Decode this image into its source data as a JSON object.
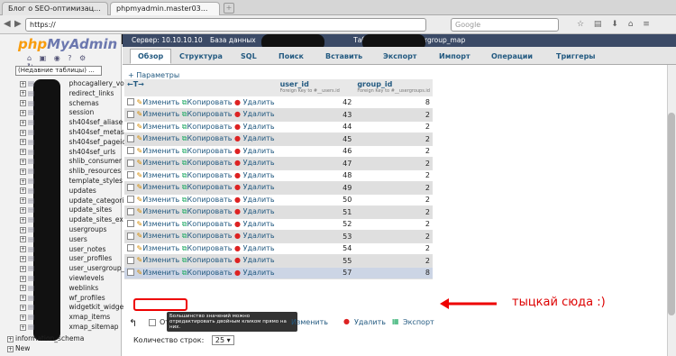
{
  "browser": {
    "tabs": [
      {
        "label": "Блог о SEO-оптимизац..."
      },
      {
        "label": "phpmyadmin.master03..."
      }
    ],
    "url_prefix": "https://",
    "search_placeholder": "Google",
    "search_engine": "8 ▾"
  },
  "sidebar": {
    "logo_php": "php",
    "logo_myadmin": "MyAdmin",
    "recent_select": "(Недавние таблицы) ...",
    "items": [
      "phocagallery_vo",
      "redirect_links",
      "schemas",
      "session",
      "sh404sef_aliase",
      "sh404sef_metas",
      "sh404sef_pageic",
      "sh404sef_urls",
      "shlib_consumer",
      "shlib_resources",
      "template_styles",
      "updates",
      "update_categori",
      "update_sites",
      "update_sites_ex",
      "usergroups",
      "users",
      "user_notes",
      "user_profiles",
      "user_usergroup_",
      "viewlevels",
      "weblinks",
      "wf_profiles",
      "widgetkit_widge",
      "xmap_items",
      "xmap_sitemap"
    ],
    "root_items": [
      "information_schema",
      "New"
    ]
  },
  "breadcrumb": {
    "server": "Сервер: 10.10.10.10",
    "database": "База данных",
    "table": "Таблица",
    "table_name": "user_usergroup_map"
  },
  "tabs": [
    {
      "label": "Обзор",
      "icon": "browse-icon"
    },
    {
      "label": "Структура",
      "icon": "structure-icon"
    },
    {
      "label": "SQL",
      "icon": "sql-icon"
    },
    {
      "label": "Поиск",
      "icon": "search-icon"
    },
    {
      "label": "Вставить",
      "icon": "insert-icon"
    },
    {
      "label": "Экспорт",
      "icon": "export-icon"
    },
    {
      "label": "Импорт",
      "icon": "import-icon"
    },
    {
      "label": "Операции",
      "icon": "operations-icon"
    },
    {
      "label": "Триггеры",
      "icon": "triggers-icon"
    }
  ],
  "params_label": "+ Параметры",
  "sort_arrows": "←T→",
  "columns": [
    {
      "name": "user_id",
      "fk": "Foreign Key to #__users.id"
    },
    {
      "name": "group_id",
      "fk": "Foreign Key to #__usergroups.id"
    }
  ],
  "actions": {
    "edit": "Изменить",
    "copy": "Копировать",
    "delete": "Удалить"
  },
  "rows": [
    {
      "user_id": "42",
      "group_id": "8"
    },
    {
      "user_id": "43",
      "group_id": "2"
    },
    {
      "user_id": "44",
      "group_id": "2"
    },
    {
      "user_id": "45",
      "group_id": "2"
    },
    {
      "user_id": "46",
      "group_id": "2"
    },
    {
      "user_id": "47",
      "group_id": "2"
    },
    {
      "user_id": "48",
      "group_id": "2"
    },
    {
      "user_id": "49",
      "group_id": "2"
    },
    {
      "user_id": "50",
      "group_id": "2"
    },
    {
      "user_id": "51",
      "group_id": "2"
    },
    {
      "user_id": "52",
      "group_id": "2"
    },
    {
      "user_id": "53",
      "group_id": "2"
    },
    {
      "user_id": "54",
      "group_id": "2"
    },
    {
      "user_id": "55",
      "group_id": "2"
    },
    {
      "user_id": "57",
      "group_id": "8"
    }
  ],
  "tooltip": "Большинство значений можно отредактировать двойным кликом прямо на них.",
  "bottom": {
    "check_label": "От",
    "edit": "Изменить",
    "delete": "Удалить",
    "export": "Экспорт"
  },
  "row_count_label": "Количество строк:",
  "row_count_value": "25 ▾",
  "annotation": "тыцкай сюда :)"
}
